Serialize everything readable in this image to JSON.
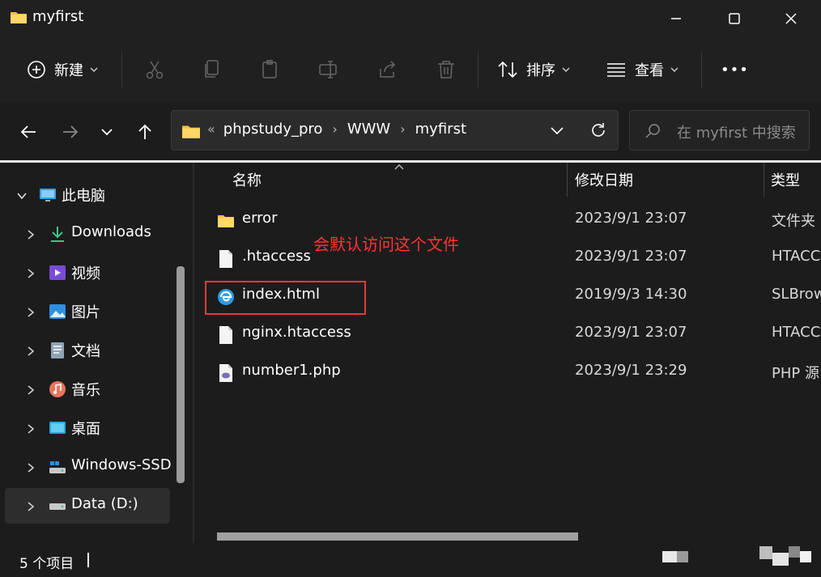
{
  "window": {
    "title": "myfirst"
  },
  "commandbar": {
    "new_label": "新建",
    "sort_label": "排序",
    "view_label": "查看",
    "more_label": "•••"
  },
  "address": {
    "overflow": "«",
    "crumbs": [
      "phpstudy_pro",
      "WWW",
      "myfirst"
    ],
    "separator": "›"
  },
  "search": {
    "placeholder": "在 myfirst 中搜索"
  },
  "sidebar": {
    "top": {
      "label": "此电脑",
      "icon": "monitor-icon"
    },
    "items": [
      {
        "label": "Downloads",
        "icon": "download-icon"
      },
      {
        "label": "视频",
        "icon": "video-icon"
      },
      {
        "label": "图片",
        "icon": "picture-icon"
      },
      {
        "label": "文档",
        "icon": "document-icon"
      },
      {
        "label": "音乐",
        "icon": "music-icon"
      },
      {
        "label": "桌面",
        "icon": "desktop-icon"
      },
      {
        "label": "Windows-SSD",
        "icon": "drive-icon"
      },
      {
        "label": "Data (D:)",
        "icon": "drive-icon"
      }
    ]
  },
  "columns": {
    "name": "名称",
    "date": "修改日期",
    "type": "类型"
  },
  "files": [
    {
      "name": "error",
      "date": "2023/9/1 23:07",
      "type": "文件夹",
      "icon": "folder-icon"
    },
    {
      "name": ".htaccess",
      "date": "2023/9/1 23:07",
      "type": "HTACCESS",
      "icon": "file-icon"
    },
    {
      "name": "index.html",
      "date": "2019/9/3 14:30",
      "type": "SLBrowser",
      "icon": "browser-icon"
    },
    {
      "name": "nginx.htaccess",
      "date": "2023/9/1 23:07",
      "type": "HTACCESS",
      "icon": "file-icon"
    },
    {
      "name": "number1.php",
      "date": "2023/9/1 23:29",
      "type": "PHP 源",
      "icon": "php-file-icon"
    }
  ],
  "annotation": {
    "text": "会默认访问这个文件",
    "color": "#ff3333"
  },
  "status": {
    "count_text": "5 个项目"
  },
  "colors": {
    "background": "#1c1c1c",
    "folder": "#f5c043",
    "accent_blue": "#2b9be6",
    "highlight_red": "#e03b3b"
  }
}
